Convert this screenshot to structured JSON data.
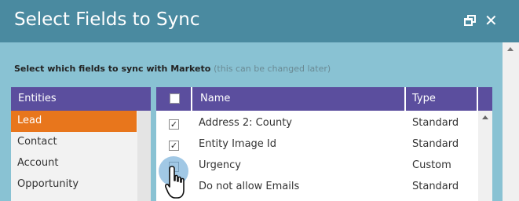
{
  "dialog": {
    "title": "Select Fields to Sync",
    "instruction": "Select which fields to sync with Marketo",
    "instruction_hint": "(this can be changed later)"
  },
  "entities": {
    "header": "Entities",
    "items": [
      {
        "label": "Lead",
        "selected": true
      },
      {
        "label": "Contact",
        "selected": false
      },
      {
        "label": "Account",
        "selected": false
      },
      {
        "label": "Opportunity",
        "selected": false
      }
    ]
  },
  "fields": {
    "headers": {
      "name": "Name",
      "type": "Type"
    },
    "rows": [
      {
        "checked": true,
        "checkmark": "✓",
        "name": "Address 2: County",
        "type": "Standard"
      },
      {
        "checked": true,
        "checkmark": "✓",
        "name": "Entity Image Id",
        "type": "Standard"
      },
      {
        "checked": false,
        "checkmark": "",
        "name": "Urgency",
        "type": "Custom"
      },
      {
        "checked": false,
        "checkmark": "",
        "name": "Do not allow Emails",
        "type": "Standard"
      }
    ]
  },
  "colors": {
    "titlebar": "#4a8aa0",
    "body": "#89c2d3",
    "header": "#5b4e9e",
    "selected": "#e8761c"
  },
  "icons": [
    "restore-icon",
    "close-icon",
    "hand-cursor-icon",
    "scroll-up-arrow-icon"
  ]
}
